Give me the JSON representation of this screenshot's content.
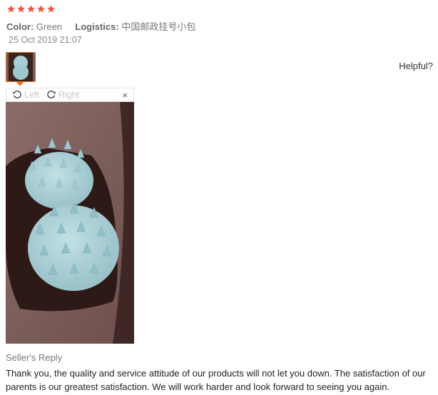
{
  "review": {
    "rating": 5,
    "star_color": "#f05545",
    "color_label": "Color:",
    "color_value": "Green",
    "logistics_label": "Logistics:",
    "logistics_value": "中国邮政挂号小包",
    "date": "25 Oct 2019 21:07",
    "helpful_label": "Helpful?"
  },
  "viewer": {
    "rotate_left_label": "Left",
    "rotate_right_label": "Right",
    "close_label": "×"
  },
  "seller_reply": {
    "title": "Seller's Reply",
    "text": "Thank you, the quality and service attitude of our products will not let you down. The satisfaction of our parents is our greatest satisfaction. We will work harder and look forward to seeing you again."
  },
  "colors": {
    "accent": "#e46f1f",
    "brush": "#a9cfd6"
  }
}
